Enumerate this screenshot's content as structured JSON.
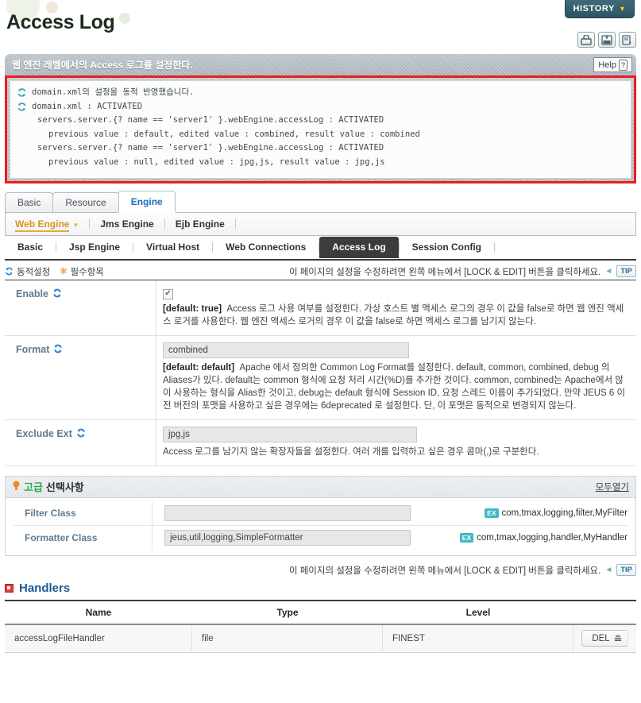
{
  "header": {
    "title": "Access Log",
    "history_label": "HISTORY",
    "history_caret": "▼",
    "icons": [
      {
        "name": "reload-deploy-icon",
        "label": "reload"
      },
      {
        "name": "xml-export-icon",
        "label": "XML"
      },
      {
        "name": "backup-restore-icon",
        "label": "backup"
      }
    ]
  },
  "description": {
    "text": "웹 엔진 레벨에서의 Access 로그를 설정한다.",
    "help_label": "Help",
    "help_mark": "?"
  },
  "log": {
    "lines": [
      {
        "indent": 0,
        "icon": true,
        "text": "domain.xml의 설정을 동적 반영했습니다."
      },
      {
        "indent": 0,
        "icon": true,
        "text": "domain.xml : ACTIVATED"
      },
      {
        "indent": 1,
        "icon": false,
        "text": "servers.server.{? name == 'server1' }.webEngine.accessLog : ACTIVATED"
      },
      {
        "indent": 2,
        "icon": false,
        "text": "previous value : default, edited value : combined, result value : combined"
      },
      {
        "indent": 1,
        "icon": false,
        "text": "servers.server.{? name == 'server1' }.webEngine.accessLog : ACTIVATED"
      },
      {
        "indent": 2,
        "icon": false,
        "text": "previous value : null, edited value : jpg,js, result value : jpg,js"
      }
    ]
  },
  "tabs_primary": [
    {
      "label": "Basic",
      "active": false
    },
    {
      "label": "Resource",
      "active": false
    },
    {
      "label": "Engine",
      "active": true
    }
  ],
  "engine_nav": [
    {
      "label": "Web Engine",
      "active": true,
      "caret": "▼"
    },
    {
      "label": "Jms Engine",
      "active": false
    },
    {
      "label": "Ejb Engine",
      "active": false
    }
  ],
  "tabs_secondary": [
    {
      "label": "Basic",
      "active": false
    },
    {
      "label": "Jsp Engine",
      "active": false
    },
    {
      "label": "Virtual Host",
      "active": false
    },
    {
      "label": "Web Connections",
      "active": false
    },
    {
      "label": "Access Log",
      "active": true
    },
    {
      "label": "Session Config",
      "active": false
    }
  ],
  "legend": {
    "dynamic_label": "동적설정",
    "required_label": "필수항목",
    "required_mark": "✻",
    "note": "이 페이지의 설정을 수정하려면 왼쪽 메뉴에서 [LOCK & EDIT] 버튼을 클릭하세요.",
    "tip_label": "TIP",
    "tip_arrow": "◄"
  },
  "settings": [
    {
      "label": "Enable",
      "dynamic": true,
      "control": "checkbox",
      "checked": true,
      "check_mark": "✔",
      "default_tag": "[default: true]",
      "description": "Access 로그 사용 여부를 설정한다. 가상 호스트 별 액세스 로그의 경우 이 값을 false로 하면 웹 엔진 액세스 로거를 사용한다. 웹 엔진 액세스 로거의 경우 이 값을 false로 하면 액세스 로그를 남기지 않는다."
    },
    {
      "label": "Format",
      "dynamic": true,
      "control": "text",
      "value": "combined",
      "default_tag": "[default: default]",
      "description": "Apache 에서 정의한 Common Log Format를 설정한다. default, common, combined, debug 의 Aliases가 있다. default는 common 형식에 요청 처리 시간(%D)를 추가한 것이다. common, combined는 Apache에서 많이 사용하는 형식을 Alias한 것이고, debug는 default 형식에 Session ID, 요청 스레드 이름이 추가되었다. 만약 JEUS 6 이전 버전의 포맷을 사용하고 싶은 경우에는 6deprecated 로 설정한다. 단, 이 포맷은 동적으로 변경되지 않는다."
    },
    {
      "label": "Exclude Ext",
      "dynamic": true,
      "control": "text",
      "value": "jpg,js",
      "default_tag": "",
      "description": "Access 로그를 남기지 않는 확장자들을 설정한다. 여러 개를 입력하고 싶은 경우 콤마(,)로 구분한다."
    }
  ],
  "advanced": {
    "title_k1": "고급",
    "title_k2": "선택사항",
    "bulb": "⁈",
    "open_all": "모두열기",
    "rows": [
      {
        "label": "Filter Class",
        "value": "",
        "placeholder": "",
        "example_badge": "EX",
        "example": "com,tmax,logging,filter,MyFilter"
      },
      {
        "label": "Formatter Class",
        "value": "jeus,util,logging,SimpleFormatter",
        "placeholder": "",
        "example_badge": "EX",
        "example": "com,tmax,logging,handler,MyHandler"
      }
    ]
  },
  "handlers": {
    "note": "이 페이지의 설정을 수정하려면 왼쪽 메뉴에서 [LOCK & EDIT] 버튼을 클릭하세요.",
    "tip_label": "TIP",
    "tip_arrow": "◄",
    "title": "Handlers",
    "columns": [
      "Name",
      "Type",
      "Level"
    ],
    "rows": [
      {
        "name": "accessLogFileHandler",
        "type": "file",
        "level": "FINEST",
        "action": "DEL"
      }
    ]
  },
  "colors": {
    "accent_blue": "#1c6fb5",
    "label_blue": "#5e7b92",
    "alert_red": "#ef1c1c",
    "orange": "#d9921e",
    "teal": "#3fb8c4",
    "dark_tab": "#3c3c3c"
  }
}
